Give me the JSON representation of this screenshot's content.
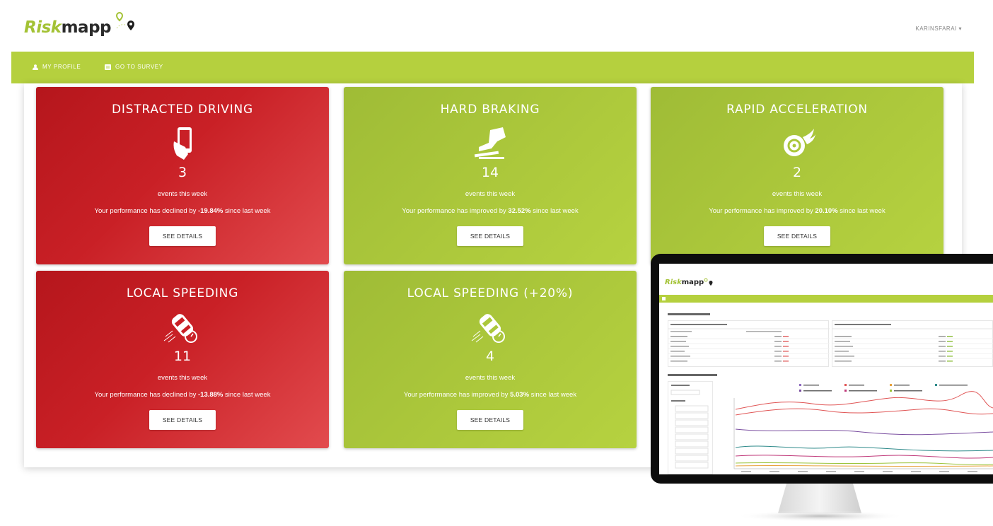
{
  "header": {
    "logo_part1": "Risk",
    "logo_part2": "mapp",
    "user_menu": "KARINSFARAI ▾"
  },
  "nav": {
    "items": [
      {
        "label": "MY PROFILE",
        "icon": "user-icon"
      },
      {
        "label": "GO TO SURVEY",
        "icon": "survey-icon"
      }
    ]
  },
  "cards": [
    {
      "title": "DISTRACTED DRIVING",
      "icon": "phone-icon",
      "count": "3",
      "subtitle": "events this week",
      "perf_prefix": "Your performance has declined by ",
      "perf_value": "-19.84%",
      "perf_suffix": " since last week",
      "button": "SEE DETAILS",
      "status": "declined"
    },
    {
      "title": "HARD BRAKING",
      "icon": "brake-pedal-icon",
      "count": "14",
      "subtitle": "events this week",
      "perf_prefix": "Your performance has improved by ",
      "perf_value": "32.52%",
      "perf_suffix": " since last week",
      "button": "SEE DETAILS",
      "status": "improved"
    },
    {
      "title": "RAPID ACCELERATION",
      "icon": "wheel-fire-icon",
      "count": "2",
      "subtitle": "events this week",
      "perf_prefix": "Your performance has improved by ",
      "perf_value": "20.10%",
      "perf_suffix": " since last week",
      "button": "SEE DETAILS",
      "status": "improved"
    },
    {
      "title": "LOCAL SPEEDING",
      "icon": "speeding-car-icon",
      "count": "11",
      "subtitle": "events this week",
      "perf_prefix": "Your performance has declined by ",
      "perf_value": "-13.88%",
      "perf_suffix": " since last week",
      "button": "SEE DETAILS",
      "status": "declined"
    },
    {
      "title": "LOCAL SPEEDING (+20%)",
      "icon": "speeding-car-icon",
      "count": "4",
      "subtitle": "events this week",
      "perf_prefix": "Your performance has improved by ",
      "perf_value": "5.03%",
      "perf_suffix": " since last week",
      "button": "SEE DETAILS",
      "status": "improved"
    }
  ],
  "colors": {
    "brand_green": "#b5d03e",
    "declined_red": "#c92026",
    "improved_green": "#abc73b"
  },
  "monitor": {
    "logo_part1": "Risk",
    "logo_part2": "mapp"
  }
}
